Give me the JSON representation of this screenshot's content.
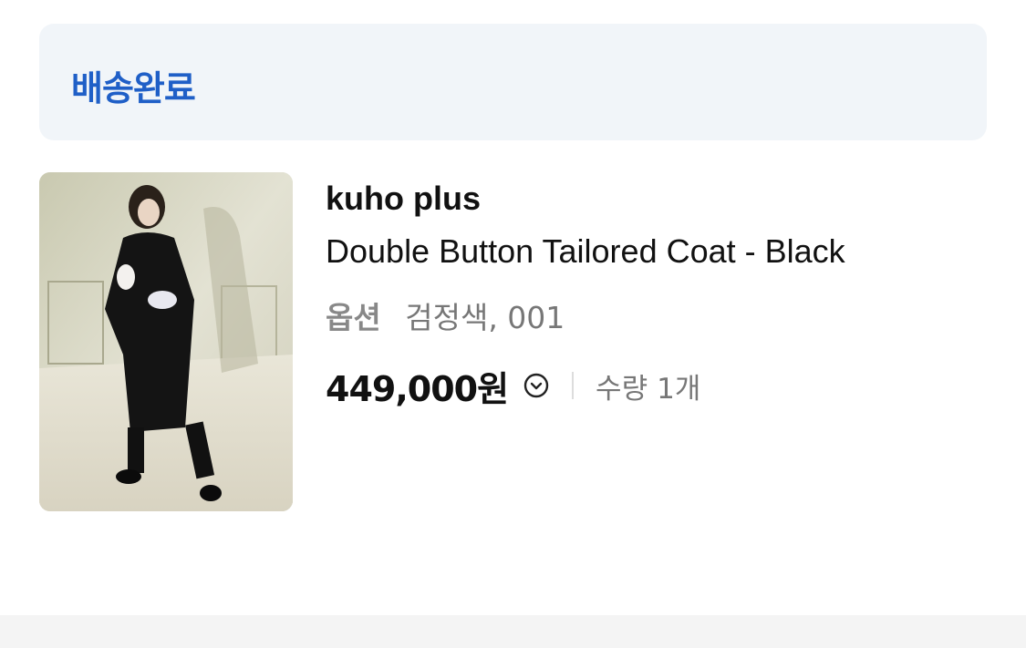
{
  "order": {
    "status": "배송완료",
    "status_color": "#1f5fc7"
  },
  "product": {
    "brand": "kuho plus",
    "name": "Double Button Tailored Coat - Black",
    "option_label": "옵션",
    "option_value": "검정색, 001",
    "price": "449,000원",
    "quantity_label": "수량",
    "quantity_value": "1개",
    "image_icon": "product-photo",
    "detail_icon": "chevron-down-circle-icon"
  }
}
